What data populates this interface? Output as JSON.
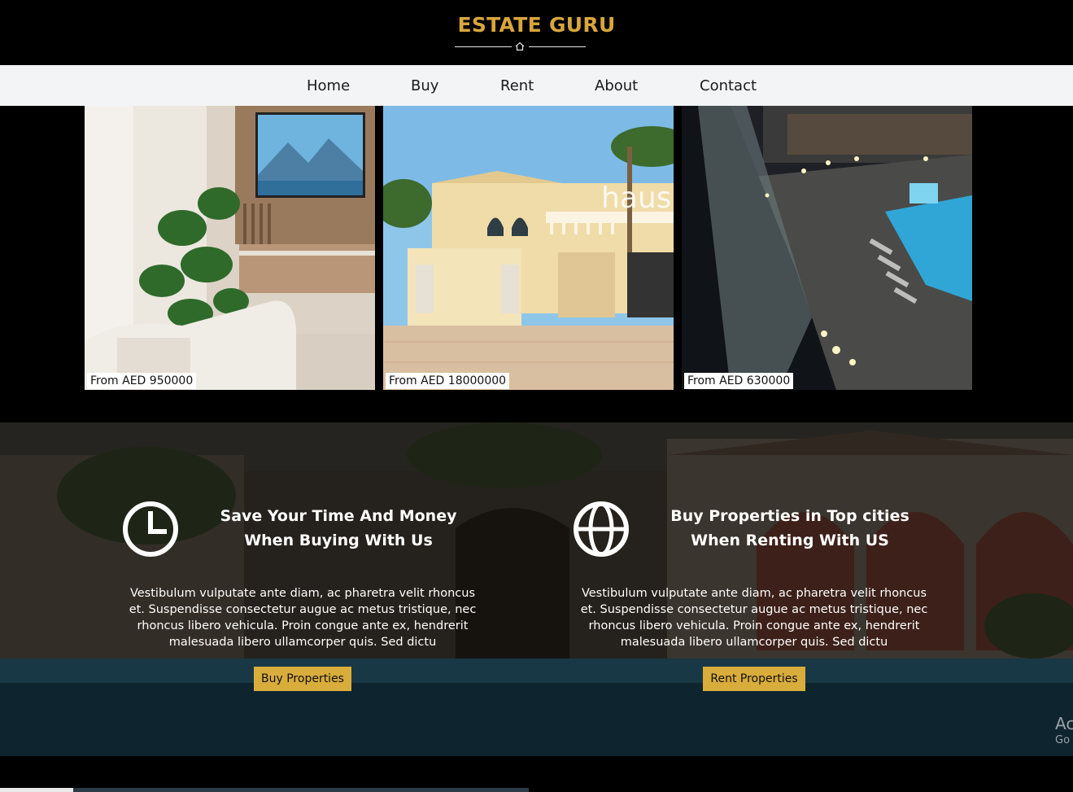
{
  "brand": {
    "title": "ESTATE GURU",
    "accent_color": "#d8a63a",
    "icon": "home-icon"
  },
  "nav": {
    "items": [
      "Home",
      "Buy",
      "Rent",
      "About",
      "Contact"
    ]
  },
  "listings": [
    {
      "price": "From AED 950000",
      "image": "living-room-photo"
    },
    {
      "price": "From AED 18000000",
      "image": "villa-exterior-photo"
    },
    {
      "price": "From AED 630000",
      "image": "rooftop-pool-night-photo"
    }
  ],
  "features": [
    {
      "icon": "clock-icon",
      "title": "Save Your Time And Money When Buying With Us",
      "text": "Vestibulum vulputate ante diam, ac pharetra velit rhoncus et. Suspendisse consectetur augue ac metus tristique, nec rhoncus libero vehicula. Proin congue ante ex, hendrerit malesuada libero ullamcorper quis. Sed dictu",
      "button": "Buy Properties"
    },
    {
      "icon": "globe-icon",
      "title": "Buy Properties in Top cities When Renting With US",
      "text": "Vestibulum vulputate ante diam, ac pharetra velit rhoncus et. Suspendisse consectetur augue ac metus tristique, nec rhoncus libero vehicula. Proin congue ante ex, hendrerit malesuada libero ullamcorper quis. Sed dictu",
      "button": "Rent Properties"
    }
  ],
  "button_color": "#d9ad3b",
  "watermark": {
    "line1": "Ac",
    "line2": "Go"
  }
}
